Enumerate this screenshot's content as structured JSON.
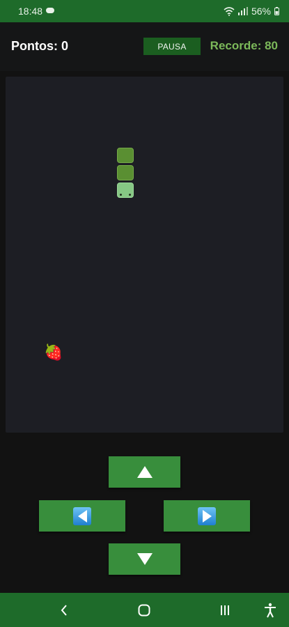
{
  "status_bar": {
    "time": "18:48",
    "battery": "56%"
  },
  "header": {
    "score_label": "Pontos: 0",
    "pause_label": "PAUSA",
    "record_label": "Recorde: 80"
  },
  "game": {
    "fruit_glyph": "🍓"
  },
  "colors": {
    "bar_green": "#1e6b2a",
    "button_green": "#388e3c",
    "record_text": "#7cb95a",
    "board_bg": "#1d1e24"
  },
  "controls": {
    "up_icon": "triangle-up-icon",
    "down_icon": "triangle-down-icon",
    "left_icon": "left-arrow-icon",
    "right_icon": "right-arrow-icon"
  }
}
